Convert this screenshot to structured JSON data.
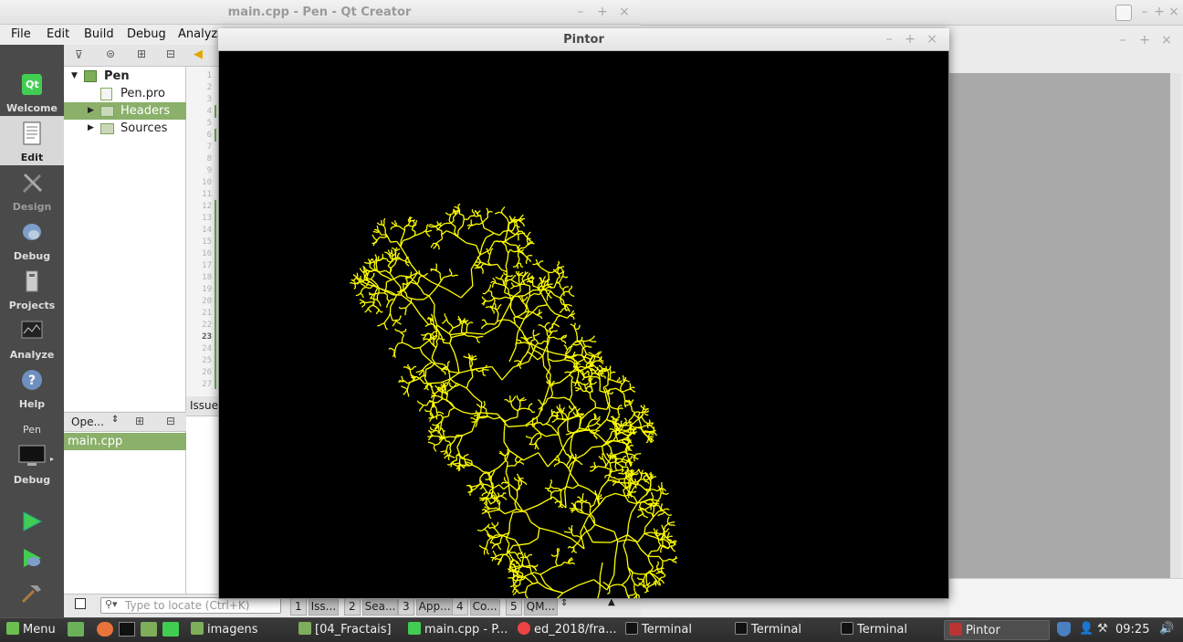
{
  "qtcreator": {
    "title": "main.cpp - Pen - Qt Creator",
    "menu": [
      "File",
      "Edit",
      "Build",
      "Debug",
      "Analyze"
    ],
    "modes": [
      {
        "label": "Welcome",
        "icon": "qt-logo-icon"
      },
      {
        "label": "Edit",
        "icon": "document-icon"
      },
      {
        "label": "Design",
        "icon": "pen-ruler-icon"
      },
      {
        "label": "Debug",
        "icon": "bug-icon"
      },
      {
        "label": "Projects",
        "icon": "folder-wrench-icon"
      },
      {
        "label": "Analyze",
        "icon": "analyze-monitor-icon"
      },
      {
        "label": "Help",
        "icon": "help-icon"
      }
    ],
    "kit": {
      "project": "Pen",
      "config": "Debug"
    },
    "project_tree": {
      "root": "Pen",
      "items": [
        "Pen.pro",
        "Headers",
        "Sources"
      ],
      "selected": "Headers"
    },
    "open_docs": {
      "combo": "Ope...",
      "files": [
        "main.cpp"
      ]
    },
    "editor": {
      "line_numbers": [
        "1",
        "2",
        "3",
        "4",
        "5",
        "6",
        "7",
        "8",
        "9",
        "10",
        "11",
        "12",
        "13",
        "14",
        "15",
        "16",
        "17",
        "18",
        "19",
        "20",
        "21",
        "22",
        "23",
        "24",
        "25",
        "26",
        "27"
      ],
      "current_line": "23"
    },
    "issues_label": "Issue",
    "locator_placeholder": "Type to locate (Ctrl+K)",
    "output_tabs": [
      {
        "n": "1",
        "label": "Iss..."
      },
      {
        "n": "2",
        "label": "Sea..."
      },
      {
        "n": "3",
        "label": "App..."
      },
      {
        "n": "4",
        "label": "Co..."
      },
      {
        "n": "5",
        "label": "QM..."
      }
    ]
  },
  "pintor": {
    "title": "Pintor",
    "fractal_color": "#ffff00",
    "background_color": "#000000"
  },
  "taskbar": {
    "menu_label": "Menu",
    "items": [
      {
        "label": "imagens",
        "icon": "folder-icon"
      },
      {
        "label": "[04_Fractais]",
        "icon": "folder-icon"
      },
      {
        "label": "main.cpp - P...",
        "icon": "qtcreator-icon"
      },
      {
        "label": "ed_2018/fra...",
        "icon": "chrome-icon"
      },
      {
        "label": "Terminal",
        "icon": "terminal-icon"
      },
      {
        "label": "Terminal",
        "icon": "terminal-icon"
      },
      {
        "label": "Terminal",
        "icon": "terminal-icon"
      },
      {
        "label": "Pintor",
        "icon": "app-window-icon"
      }
    ],
    "clock": "09:25"
  }
}
